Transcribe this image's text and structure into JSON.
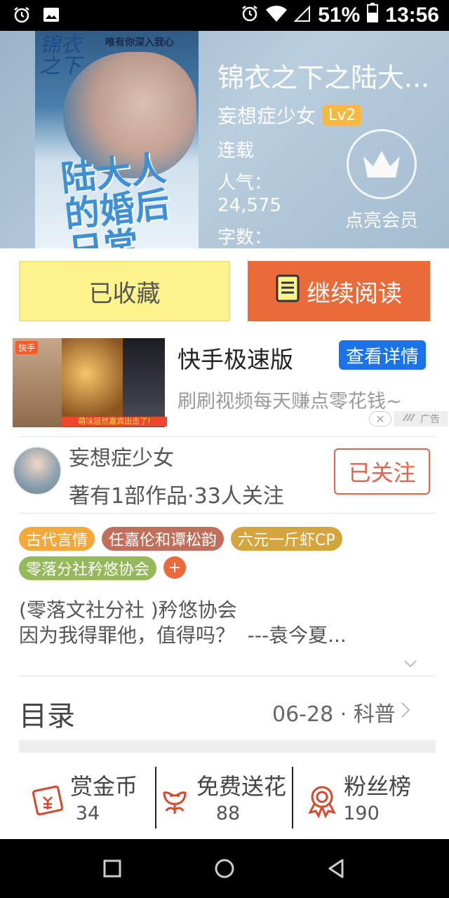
{
  "status_bar": {
    "battery": "51%",
    "time": "13:56"
  },
  "book": {
    "title": "锦衣之下之陆大...",
    "author": "妄想症少女",
    "author_level": "Lv2",
    "status": "连载",
    "popularity_label": "人气：",
    "popularity_value": "24,575",
    "word_count_label": "字数：",
    "cover": {
      "series_mark": "锦衣之下",
      "tagline": "唯有你深入我心",
      "big_title": "陆大人的婚后日常"
    }
  },
  "vip": {
    "label": "点亮会员"
  },
  "actions": {
    "favorited_label": "已收藏",
    "continue_label": "继续阅读"
  },
  "ad": {
    "logo": "快手",
    "banner": "萌味居然嘉宾出击了!",
    "title": "快手极速版",
    "detail_button": "查看详情",
    "description": "刷刷视频每天赚点零花钱~",
    "ad_tag": "广告"
  },
  "author_card": {
    "name": "妄想症少女",
    "stats": "著有1部作品·33人关注",
    "follow_label": "已关注"
  },
  "tags": [
    {
      "label": "古代言情",
      "color": "#f4a83a"
    },
    {
      "label": "任嘉伦和谭松韵",
      "color": "#c0705a"
    },
    {
      "label": "六元一斤虾CP",
      "color": "#d4a53c"
    },
    {
      "label": "零落分社矜悠协会",
      "color": "#95b85a"
    }
  ],
  "tag_add": "+",
  "intro": {
    "line1": "(零落文社分社 )矜悠协会",
    "line2": "因为我得罪他，值得吗？  ---袁今夏..."
  },
  "catalog": {
    "title": "目录",
    "info": "06-28 · 科普"
  },
  "stats": {
    "reward": {
      "label": "赏金币",
      "value": "34"
    },
    "flowers": {
      "label": "免费送花",
      "value": "88"
    },
    "fans": {
      "label": "粉丝榜",
      "value": "190"
    }
  },
  "colors": {
    "accent_orange": "#eb6a3a",
    "favorite_yellow": "#fdf38d",
    "follow_red": "#e9604c",
    "ad_blue": "#1a73e8",
    "level_badge": "#f5b942"
  }
}
